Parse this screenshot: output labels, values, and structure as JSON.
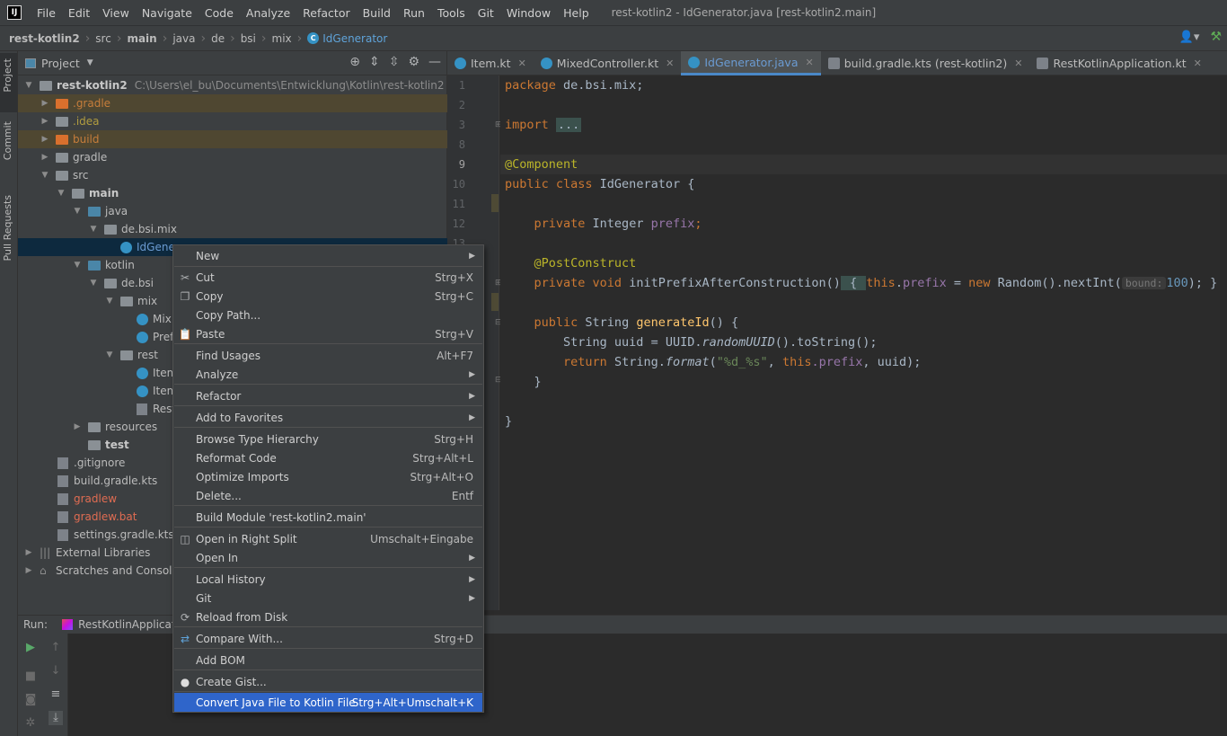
{
  "menubar": {
    "items": [
      "File",
      "Edit",
      "View",
      "Navigate",
      "Code",
      "Analyze",
      "Refactor",
      "Build",
      "Run",
      "Tools",
      "Git",
      "Window",
      "Help"
    ],
    "window_title": "rest-kotlin2 - IdGenerator.java [rest-kotlin2.main]",
    "logo_text": "IJ"
  },
  "breadcrumb": [
    "rest-kotlin2",
    "src",
    "main",
    "java",
    "de",
    "bsi",
    "mix",
    "IdGenerator"
  ],
  "tool_windows": {
    "project": "Project",
    "commit": "Commit",
    "pull_requests": "Pull Requests"
  },
  "project_panel": {
    "title": "Project",
    "tree": [
      {
        "label": "rest-kotlin2",
        "path": "C:\\Users\\el_bu\\Documents\\Entwicklung\\Kotlin\\rest-kotlin2"
      },
      {
        "label": ".gradle"
      },
      {
        "label": ".idea"
      },
      {
        "label": "build"
      },
      {
        "label": "gradle"
      },
      {
        "label": "src"
      },
      {
        "label": "main"
      },
      {
        "label": "java"
      },
      {
        "label": "de.bsi.mix"
      },
      {
        "label": "IdGener"
      },
      {
        "label": "kotlin"
      },
      {
        "label": "de.bsi"
      },
      {
        "label": "mix"
      },
      {
        "label": "Mix"
      },
      {
        "label": "Pref"
      },
      {
        "label": "rest"
      },
      {
        "label": "Item"
      },
      {
        "label": "Item"
      },
      {
        "label": "Rest"
      },
      {
        "label": "resources"
      },
      {
        "label": "test"
      },
      {
        "label": ".gitignore"
      },
      {
        "label": "build.gradle.kts"
      },
      {
        "label": "gradlew"
      },
      {
        "label": "gradlew.bat"
      },
      {
        "label": "settings.gradle.kts"
      },
      {
        "label": "External Libraries"
      },
      {
        "label": "Scratches and Consoles"
      }
    ]
  },
  "editor_tabs": [
    {
      "label": "Item.kt"
    },
    {
      "label": "MixedController.kt"
    },
    {
      "label": "IdGenerator.java"
    },
    {
      "label": "build.gradle.kts (rest-kotlin2)"
    },
    {
      "label": "RestKotlinApplication.kt"
    }
  ],
  "line_numbers": [
    "1",
    "2",
    "3",
    "8",
    "9",
    "10",
    "11",
    "12",
    "13"
  ],
  "code": {
    "l1_kw": "package",
    "l1_rest": " de.bsi.mix;",
    "l3_kw": "import",
    "l3_fold": "...",
    "l9": "@Component",
    "l10_kw": "public class",
    "l10_rest": " IdGenerator {",
    "l12_kw": "private",
    "l12_type": " Integer ",
    "l12_field": "prefix",
    "l12_end": ";",
    "l14": "@PostConstruct",
    "l15_kw": "private void",
    "l15_name": " initPrefixAfterConstruction",
    "l15_p": "()",
    "l15_b": " { ",
    "l15_this": "this",
    "l15_dot": ".",
    "l15_field": "prefix",
    "l15_eq": " = ",
    "l15_new": "new",
    "l15_call": " Random().nextInt(",
    "l15_hint": "bound:",
    "l15_num": "100",
    "l15_end": "); }",
    "l17_kw": "public",
    "l17_type": " String ",
    "l17_name": "generateId",
    "l17_end": "() {",
    "l18_a": "String uuid = UUID.",
    "l18_m": "randomUUID",
    "l18_b": "().toString();",
    "l19_kw": "return",
    "l19_a": " String.",
    "l19_m": "format",
    "l19_p": "(",
    "l19_str": "\"%d_%s\"",
    "l19_c": ", ",
    "l19_this": "this",
    "l19_f": ".prefix",
    "l19_end": ", uuid);",
    "l20": "}",
    "l22": "}"
  },
  "run_panel": {
    "label": "Run:",
    "tab": "RestKotlinApplicatio"
  },
  "context_menu": {
    "items": [
      {
        "label": "New",
        "shortcut": ""
      },
      {
        "label": "Cut",
        "shortcut": "Strg+X"
      },
      {
        "label": "Copy",
        "shortcut": "Strg+C"
      },
      {
        "label": "Copy Path...",
        "shortcut": ""
      },
      {
        "label": "Paste",
        "shortcut": "Strg+V"
      },
      {
        "label": "Find Usages",
        "shortcut": "Alt+F7"
      },
      {
        "label": "Analyze",
        "shortcut": ""
      },
      {
        "label": "Refactor",
        "shortcut": ""
      },
      {
        "label": "Add to Favorites",
        "shortcut": ""
      },
      {
        "label": "Browse Type Hierarchy",
        "shortcut": "Strg+H"
      },
      {
        "label": "Reformat Code",
        "shortcut": "Strg+Alt+L"
      },
      {
        "label": "Optimize Imports",
        "shortcut": "Strg+Alt+O"
      },
      {
        "label": "Delete...",
        "shortcut": "Entf"
      },
      {
        "label": "Build Module 'rest-kotlin2.main'",
        "shortcut": ""
      },
      {
        "label": "Open in Right Split",
        "shortcut": "Umschalt+Eingabe"
      },
      {
        "label": "Open In",
        "shortcut": ""
      },
      {
        "label": "Local History",
        "shortcut": ""
      },
      {
        "label": "Git",
        "shortcut": ""
      },
      {
        "label": "Reload from Disk",
        "shortcut": ""
      },
      {
        "label": "Compare With...",
        "shortcut": "Strg+D"
      },
      {
        "label": "Add BOM",
        "shortcut": ""
      },
      {
        "label": "Create Gist...",
        "shortcut": ""
      },
      {
        "label": "Convert Java File to Kotlin File",
        "shortcut": "Strg+Alt+Umschalt+K"
      }
    ]
  },
  "colors": {
    "accent": "#2f65ca",
    "tab_underline": "#4a88c7",
    "panel": "#3c3f41",
    "editor": "#2b2b2b"
  }
}
